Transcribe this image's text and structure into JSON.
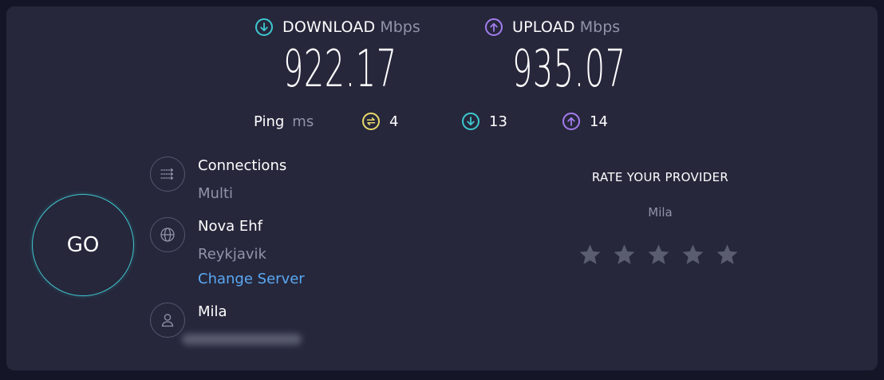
{
  "download": {
    "label": "DOWNLOAD",
    "unit": "Mbps",
    "value": "922.17",
    "icon": "arrow-down-circle-icon",
    "color": "#3ec8cf"
  },
  "upload": {
    "label": "UPLOAD",
    "unit": "Mbps",
    "value": "935.07",
    "icon": "arrow-up-circle-icon",
    "color": "#a37dee"
  },
  "ping": {
    "label": "Ping",
    "unit": "ms",
    "idle": {
      "value": "4",
      "icon": "ping-idle-icon",
      "color": "#e8d96a"
    },
    "download": {
      "value": "13",
      "icon": "arrow-down-circle-icon",
      "color": "#3ec8cf"
    },
    "upload": {
      "value": "14",
      "icon": "arrow-up-circle-icon",
      "color": "#a37dee"
    }
  },
  "go_button": {
    "label": "GO",
    "color": "#3ec8cf"
  },
  "connections": {
    "title": "Connections",
    "value": "Multi",
    "icon": "connections-icon"
  },
  "server": {
    "name": "Nova Ehf",
    "location": "Reykjavik",
    "change_label": "Change Server",
    "icon": "globe-icon"
  },
  "user": {
    "isp": "Mila",
    "icon": "user-icon"
  },
  "rating": {
    "title": "RATE YOUR PROVIDER",
    "provider": "Mila",
    "star_count": 5,
    "selected": 0,
    "star_color": "#5a5c70"
  }
}
